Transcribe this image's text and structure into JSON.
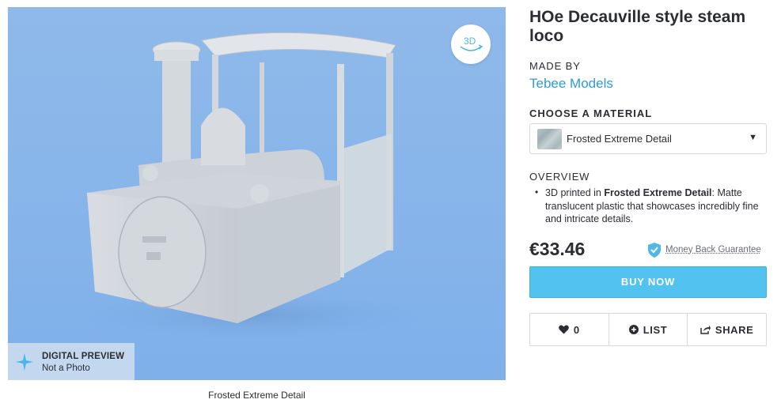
{
  "preview": {
    "view_3d_label": "3D",
    "badge_title": "DIGITAL PREVIEW",
    "badge_subtitle": "Not a Photo",
    "caption": "Frosted Extreme Detail"
  },
  "product": {
    "title": "HOe Decauville style steam loco",
    "made_by_label": "MADE BY",
    "maker": "Tebee Models",
    "material_label": "CHOOSE A MATERIAL",
    "material_selected": "Frosted Extreme Detail",
    "overview_label": "OVERVIEW",
    "overview_prefix": "3D printed in ",
    "overview_material": "Frosted Extreme Detail",
    "overview_rest": ": Matte translucent plastic that showcases incredibly fine and intricate details.",
    "price": "€33.46",
    "guarantee": "Money Back Guarantee",
    "buy_label": "BUY NOW"
  },
  "actions": {
    "likes": "0",
    "list_label": "LIST",
    "share_label": "SHARE"
  },
  "colors": {
    "accent": "#52c3f1",
    "link": "#2c9cd8",
    "preview_bg": "#8ab6ea"
  },
  "icons": [
    "3d-rotate-icon",
    "sparkle-icon",
    "chevron-down-icon",
    "shield-check-icon",
    "heart-icon",
    "plus-circle-icon",
    "share-icon"
  ]
}
